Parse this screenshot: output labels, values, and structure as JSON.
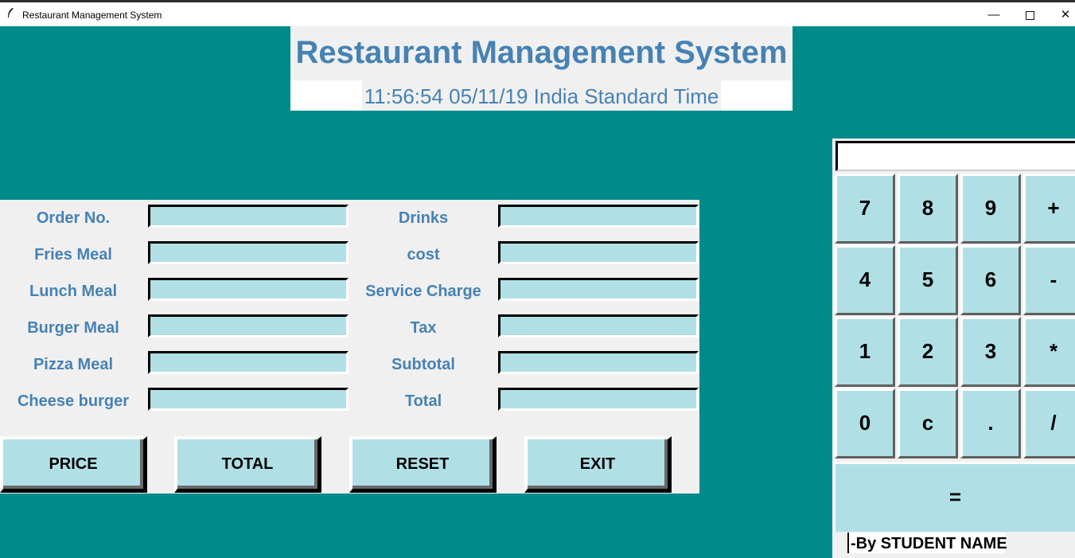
{
  "window": {
    "title": "Restaurant Management System",
    "app_icon": "feather-icon",
    "controls": {
      "minimize": "—",
      "close": "✕"
    }
  },
  "header": {
    "title": "Restaurant Management System",
    "datetime": "11:56:54 05/11/19 India Standard Time"
  },
  "form": {
    "left_fields": [
      {
        "label": "Order No.",
        "value": ""
      },
      {
        "label": "Fries Meal",
        "value": ""
      },
      {
        "label": "Lunch Meal",
        "value": ""
      },
      {
        "label": "Burger Meal",
        "value": ""
      },
      {
        "label": "Pizza Meal",
        "value": ""
      },
      {
        "label": "Cheese burger",
        "value": ""
      }
    ],
    "right_fields": [
      {
        "label": "Drinks",
        "value": ""
      },
      {
        "label": "cost",
        "value": ""
      },
      {
        "label": "Service Charge",
        "value": ""
      },
      {
        "label": "Tax",
        "value": ""
      },
      {
        "label": "Subtotal",
        "value": ""
      },
      {
        "label": "Total",
        "value": ""
      }
    ]
  },
  "buttons": {
    "price": "PRICE",
    "total": "TOTAL",
    "reset": "RESET",
    "exit": "EXIT"
  },
  "calculator": {
    "display": "",
    "keys": [
      "7",
      "8",
      "9",
      "+",
      "4",
      "5",
      "6",
      "-",
      "1",
      "2",
      "3",
      "*",
      "0",
      "c",
      ".",
      "/"
    ],
    "equals": "="
  },
  "credit": "-By STUDENT NAME",
  "colors": {
    "background": "#008b8b",
    "panel": "#f0f0f0",
    "accent_text": "#4682b4",
    "field": "#b0e0e6"
  }
}
